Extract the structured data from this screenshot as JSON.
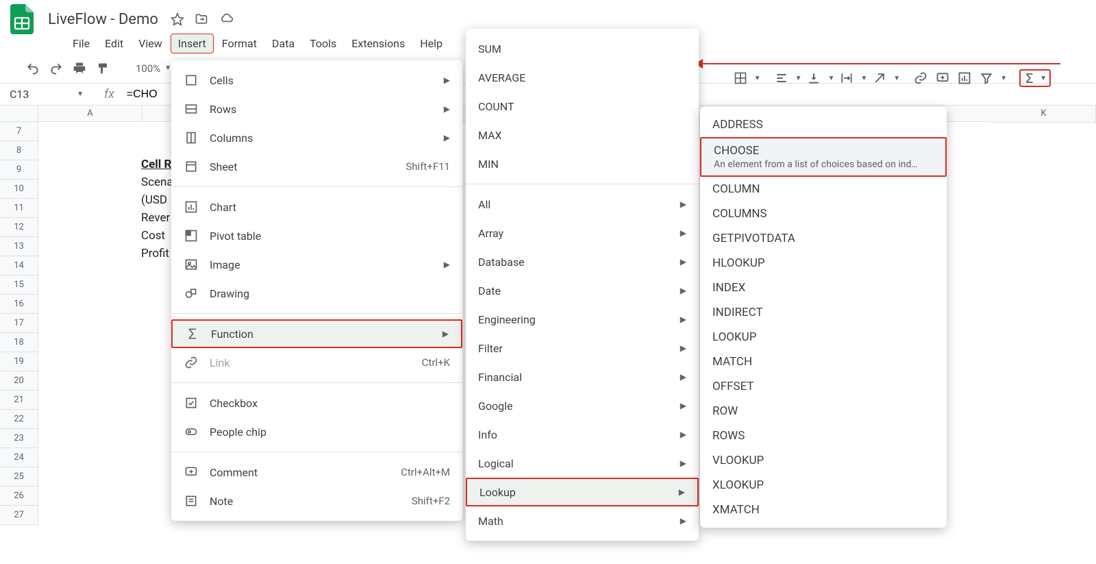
{
  "title": "LiveFlow - Demo",
  "menubar": [
    "File",
    "Edit",
    "View",
    "Insert",
    "Format",
    "Data",
    "Tools",
    "Extensions",
    "Help"
  ],
  "toolbar": {
    "zoom": "100%"
  },
  "fx": {
    "cellref": "C13",
    "formula": "=CHO"
  },
  "sheet": {
    "cols": [
      "A",
      "K"
    ],
    "rows": [
      7,
      8,
      9,
      10,
      11,
      12,
      13,
      14,
      15,
      16,
      17,
      18,
      19,
      20,
      21,
      22,
      23,
      24,
      25,
      26,
      27
    ],
    "cells": {
      "heading": "Cell R",
      "lines": [
        "Scena",
        "",
        "(USD",
        "Rever",
        "Cost",
        "Profit"
      ]
    }
  },
  "insert_menu": [
    {
      "icon": "cells",
      "label": "Cells",
      "arrow": true
    },
    {
      "icon": "rows",
      "label": "Rows",
      "arrow": true
    },
    {
      "icon": "cols",
      "label": "Columns",
      "arrow": true
    },
    {
      "icon": "sheet",
      "label": "Sheet",
      "shortcut": "Shift+F11"
    },
    {
      "sep": true
    },
    {
      "icon": "chart",
      "label": "Chart"
    },
    {
      "icon": "pivot",
      "label": "Pivot table"
    },
    {
      "icon": "image",
      "label": "Image",
      "arrow": true
    },
    {
      "icon": "drawing",
      "label": "Drawing"
    },
    {
      "sep": true
    },
    {
      "icon": "sigma",
      "label": "Function",
      "arrow": true,
      "hover": true,
      "red": true
    },
    {
      "icon": "link",
      "label": "Link",
      "shortcut": "Ctrl+K",
      "disabled": true
    },
    {
      "sep": true
    },
    {
      "icon": "checkbox",
      "label": "Checkbox"
    },
    {
      "icon": "people",
      "label": "People chip"
    },
    {
      "sep": true
    },
    {
      "icon": "comment",
      "label": "Comment",
      "shortcut": "Ctrl+Alt+M"
    },
    {
      "icon": "note",
      "label": "Note",
      "shortcut": "Shift+F2"
    }
  ],
  "function_menu": {
    "quick": [
      "SUM",
      "AVERAGE",
      "COUNT",
      "MAX",
      "MIN"
    ],
    "cats": [
      "All",
      "Array",
      "Database",
      "Date",
      "Engineering",
      "Filter",
      "Financial",
      "Google",
      "Info",
      "Logical",
      "Lookup",
      "Math"
    ]
  },
  "lookup_menu": [
    {
      "label": "ADDRESS"
    },
    {
      "label": "CHOOSE",
      "desc": "An element from a list of choices based on ind…",
      "hover": true,
      "red": true
    },
    {
      "label": "COLUMN"
    },
    {
      "label": "COLUMNS"
    },
    {
      "label": "GETPIVOTDATA"
    },
    {
      "label": "HLOOKUP"
    },
    {
      "label": "INDEX"
    },
    {
      "label": "INDIRECT"
    },
    {
      "label": "LOOKUP"
    },
    {
      "label": "MATCH"
    },
    {
      "label": "OFFSET"
    },
    {
      "label": "ROW"
    },
    {
      "label": "ROWS"
    },
    {
      "label": "VLOOKUP"
    },
    {
      "label": "XLOOKUP"
    },
    {
      "label": "XMATCH"
    }
  ]
}
